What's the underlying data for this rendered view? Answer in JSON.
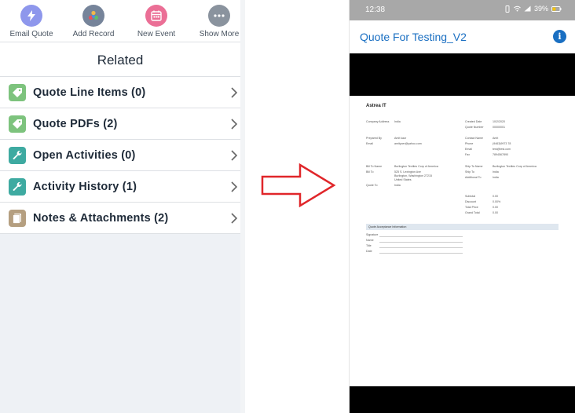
{
  "left": {
    "actions": [
      {
        "label": "Email Quote",
        "icon": "lightning-icon",
        "color": "#8e97ec"
      },
      {
        "label": "Add Record",
        "icon": "add-record-icon",
        "color": "#76849a"
      },
      {
        "label": "New Event",
        "icon": "calendar-icon",
        "color": "#eb6f96"
      },
      {
        "label": "Show More",
        "icon": "more-icon",
        "color": "#8a939e"
      }
    ],
    "related_title": "Related",
    "related_items": [
      {
        "label": "Quote Line Items (0)",
        "icon": "tag-icon",
        "color": "#7dc37d"
      },
      {
        "label": "Quote PDFs (2)",
        "icon": "tag-icon",
        "color": "#7dc37d"
      },
      {
        "label": "Open Activities (0)",
        "icon": "wrench-icon",
        "color": "#3eaaa1"
      },
      {
        "label": "Activity History (1)",
        "icon": "wrench-icon",
        "color": "#3eaaa1"
      },
      {
        "label": "Notes & Attachments (2)",
        "icon": "notes-icon",
        "color": "#b59f80"
      }
    ]
  },
  "phone": {
    "status": {
      "time": "12:38",
      "battery": "39%"
    },
    "title": "Quote For Testing_V2",
    "info_icon": "i",
    "doc": {
      "company": "Astrea IT",
      "company_address_label": "Company Address",
      "company_address": "India",
      "created_date_label": "Created Date",
      "created_date": "10/2/2020",
      "quote_number_label": "Quote Number",
      "quote_number": "00000001",
      "prepared_by_label": "Prepared By",
      "prepared_by": "Amit kaur",
      "email_label": "Email",
      "email": "amitycer@yahoo.com",
      "contact_name_label": "Contact Name",
      "contact_name": "Amit",
      "phone_label": "Phone",
      "phone": "(9463)9973 78",
      "email2_label": "Email",
      "email2": "test@test.com",
      "fax_label": "Fax",
      "fax": "7894567890",
      "bill_to_name_label": "Bill To Name",
      "bill_to_name": "Burlington Textiles Corp of America",
      "bill_to_label": "Bill To",
      "bill_to_1": "525 S. Lexington Ave",
      "bill_to_2": "Burlington, Washington 27215",
      "bill_to_3": "United States",
      "quote_to_label": "Quote To",
      "quote_to": "India",
      "ship_to_name_label": "Ship To Name",
      "ship_to_name": "Burlington Textiles Corp of America",
      "ship_to_label": "Ship To",
      "ship_to": "India",
      "additional_to_label": "Additional To",
      "additional_to": "India",
      "subtotal_label": "Subtotal",
      "subtotal": "0.00",
      "discount_label": "Discount",
      "discount": "0.00%",
      "total_price_label": "Total Price",
      "total_price": "0.00",
      "grand_total_label": "Grand Total",
      "grand_total": "0.00",
      "acceptance_header": "Quote Acceptance Information",
      "signature_label": "Signature",
      "name_label": "Name",
      "title_label": "Title",
      "date_label": "Date"
    }
  },
  "colors": {
    "accent": "#1a6fc2",
    "arrow": "#e0262a"
  }
}
